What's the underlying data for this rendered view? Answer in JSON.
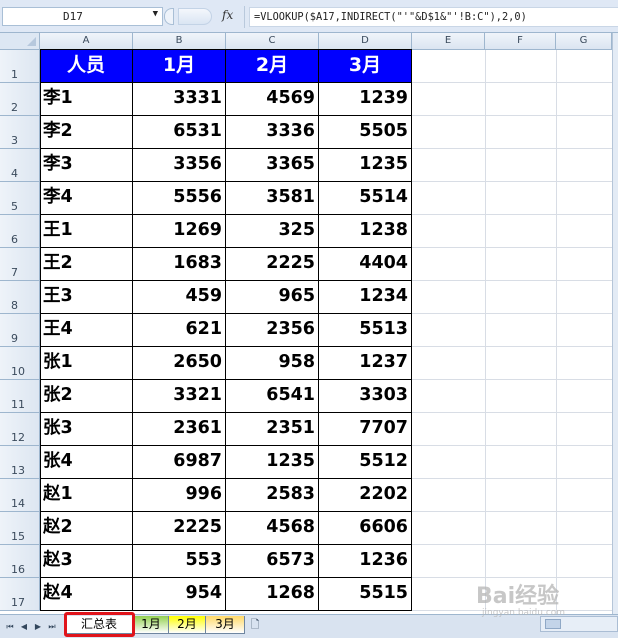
{
  "formula_bar": {
    "name_box": "D17",
    "fx_label": "fx",
    "formula": "=VLOOKUP($A17,INDIRECT(\"'\"&D$1&\"'!B:C\"),2,0)"
  },
  "columns": [
    "A",
    "B",
    "C",
    "D",
    "E",
    "F",
    "G"
  ],
  "row_numbers": [
    "1",
    "2",
    "3",
    "4",
    "5",
    "6",
    "7",
    "8",
    "9",
    "10",
    "11",
    "12",
    "13",
    "14",
    "15",
    "16",
    "17"
  ],
  "table": {
    "headers": [
      "人员",
      "1月",
      "2月",
      "3月"
    ],
    "rows": [
      {
        "name": "李1",
        "m1": "3331",
        "m2": "4569",
        "m3": "1239"
      },
      {
        "name": "李2",
        "m1": "6531",
        "m2": "3336",
        "m3": "5505"
      },
      {
        "name": "李3",
        "m1": "3356",
        "m2": "3365",
        "m3": "1235"
      },
      {
        "name": "李4",
        "m1": "5556",
        "m2": "3581",
        "m3": "5514"
      },
      {
        "name": "王1",
        "m1": "1269",
        "m2": "325",
        "m3": "1238"
      },
      {
        "name": "王2",
        "m1": "1683",
        "m2": "2225",
        "m3": "4404"
      },
      {
        "name": "王3",
        "m1": "459",
        "m2": "965",
        "m3": "1234"
      },
      {
        "name": "王4",
        "m1": "621",
        "m2": "2356",
        "m3": "5513"
      },
      {
        "name": "张1",
        "m1": "2650",
        "m2": "958",
        "m3": "1237"
      },
      {
        "name": "张2",
        "m1": "3321",
        "m2": "6541",
        "m3": "3303"
      },
      {
        "name": "张3",
        "m1": "2361",
        "m2": "2351",
        "m3": "7707"
      },
      {
        "name": "张4",
        "m1": "6987",
        "m2": "1235",
        "m3": "5512"
      },
      {
        "name": "赵1",
        "m1": "996",
        "m2": "2583",
        "m3": "2202"
      },
      {
        "name": "赵2",
        "m1": "2225",
        "m2": "4568",
        "m3": "6606"
      },
      {
        "name": "赵3",
        "m1": "553",
        "m2": "6573",
        "m3": "1236"
      },
      {
        "name": "赵4",
        "m1": "954",
        "m2": "1268",
        "m3": "5515"
      }
    ]
  },
  "sheet_tabs": [
    {
      "label": "汇总表",
      "active": true,
      "color": "#ffffff"
    },
    {
      "label": "1月",
      "active": false,
      "color": "#92d050"
    },
    {
      "label": "2月",
      "active": false,
      "color": "#ffff00"
    },
    {
      "label": "3月",
      "active": false,
      "color": "#ffd966"
    }
  ],
  "colors": {
    "header_fill": "#0000ff",
    "header_text": "#ffffff",
    "highlight": "#e0141b"
  },
  "watermark": {
    "logo": "Bai经验",
    "url": "jingyan.baidu.com"
  }
}
